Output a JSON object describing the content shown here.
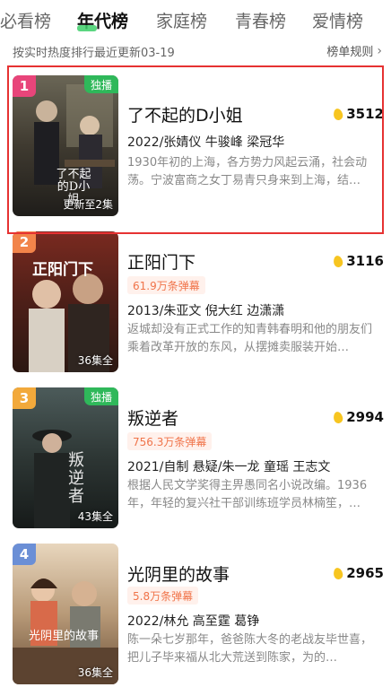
{
  "tabs": [
    {
      "label": "必看榜"
    },
    {
      "label": "年代榜"
    },
    {
      "label": "家庭榜"
    },
    {
      "label": "青春榜"
    },
    {
      "label": "爱情榜"
    }
  ],
  "active_tab": "年代榜",
  "subheader": {
    "update_text": "按实时热度排行最近更新03-19",
    "rules_label": "榜单规则"
  },
  "items": [
    {
      "rank": "1",
      "exclusive": "独播",
      "title": "了不起的D小姐",
      "heat": "3512",
      "danmu": "",
      "meta": "2022/张婧仪 牛骏峰 梁冠华",
      "desc": "1930年初的上海，各方势力风起云涌，社会动荡。宁波富商之女丁易青只身来到上海，结…",
      "episodes": "更新至2集",
      "poster_text": "了不起的D小姐"
    },
    {
      "rank": "2",
      "exclusive": "",
      "title": "正阳门下",
      "heat": "3116",
      "danmu": "61.9万条弹幕",
      "meta": "2013/朱亚文 倪大红 边潇潇",
      "desc": "返城却没有正式工作的知青韩春明和他的朋友们乘着改革开放的东风，从摆摊卖服装开始…",
      "episodes": "36集全",
      "poster_text": "正阳门下"
    },
    {
      "rank": "3",
      "exclusive": "独播",
      "title": "叛逆者",
      "heat": "2994",
      "danmu": "756.3万条弹幕",
      "meta": "2021/自制 悬疑/朱一龙 童瑶 王志文",
      "desc": "根据人民文学奖得主畀愚同名小说改编。1936年，年轻的复兴社干部训练班学员林楠笙，…",
      "episodes": "43集全",
      "poster_text": "叛逆者"
    },
    {
      "rank": "4",
      "exclusive": "",
      "title": "光阴里的故事",
      "heat": "2965",
      "danmu": "5.8万条弹幕",
      "meta": "2022/林允 高至霆 葛铮",
      "desc": "陈一朵七岁那年，爸爸陈大冬的老战友毕世喜，把儿子毕来福从北大荒送到陈家，为的…",
      "episodes": "36集全",
      "poster_text": "光阴里的故事"
    }
  ],
  "colors": {
    "rank1": "#e8457a",
    "rank2": "#f2844a",
    "rank3": "#f2a93b",
    "rank4": "#6b8fd6",
    "exclusive": "#2fb85a",
    "tab_underline": "#3ecf6a",
    "selection_box": "#e63232"
  }
}
